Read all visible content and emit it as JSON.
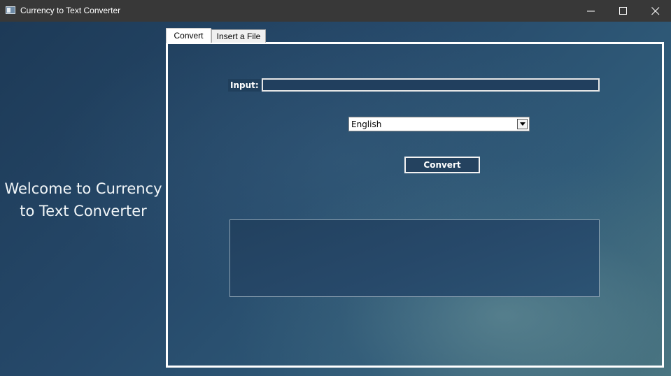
{
  "window": {
    "title": "Currency to Text Converter",
    "controls": [
      "minimize-icon",
      "maximize-icon",
      "close-icon"
    ]
  },
  "welcome": {
    "line1": "Welcome to Currency",
    "line2": "to Text Converter"
  },
  "tabs": [
    {
      "label": "Convert",
      "selected": true
    },
    {
      "label": "Insert a File",
      "selected": false
    }
  ],
  "form": {
    "input_label": "Input:",
    "input_value": "",
    "language_selected": "English",
    "convert_label": "Convert",
    "output_value": ""
  },
  "colors": {
    "titlebar": "#383838",
    "panel_border": "#ffffff",
    "background": "#26496a"
  }
}
